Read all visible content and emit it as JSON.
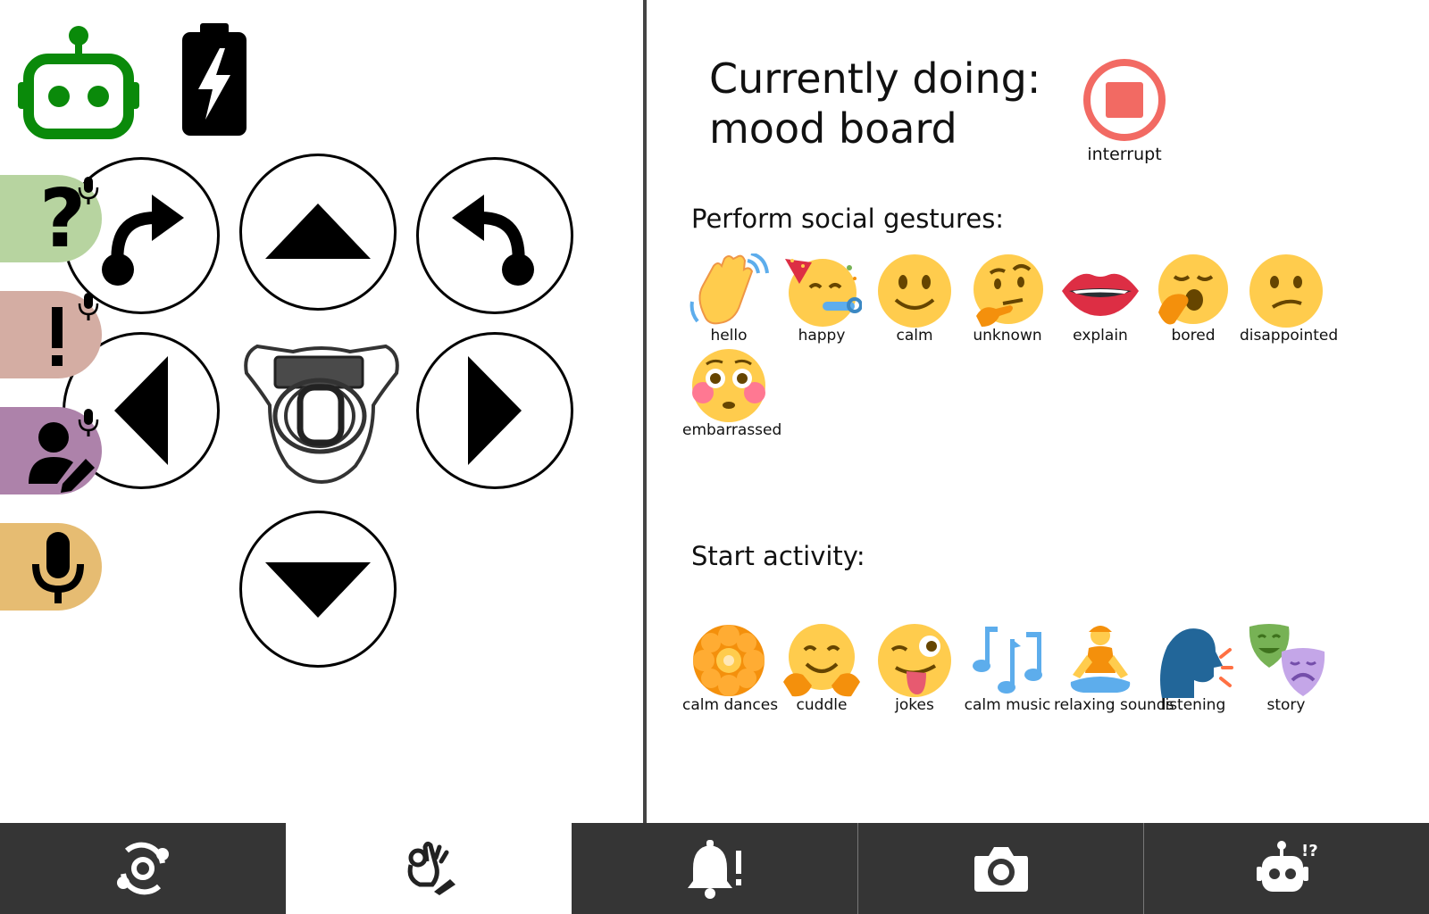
{
  "status": {
    "robot_icon": "robot-connected-icon",
    "robot_color": "#0a8a0a",
    "battery_icon": "battery-charging-icon"
  },
  "side_buttons": [
    {
      "name": "help-button",
      "icon": "question-mark-icon",
      "color": "#b7d4a0"
    },
    {
      "name": "alert-button",
      "icon": "exclamation-icon",
      "color": "#d4ada3"
    },
    {
      "name": "user-edit-button",
      "icon": "user-edit-icon",
      "color": "#ad82aa"
    },
    {
      "name": "microphone-button",
      "icon": "microphone-icon",
      "color": "#e6bc72"
    }
  ],
  "navigation": {
    "buttons": [
      "turn-right",
      "forward",
      "turn-left",
      "left",
      "right",
      "backward"
    ],
    "center_icon": "robot-head-icon"
  },
  "current": {
    "line1": "Currently doing:",
    "line2": "mood board"
  },
  "interrupt": {
    "label": "interrupt",
    "color": "#f26a63"
  },
  "gestures": {
    "title": "Perform social gestures:",
    "items": [
      {
        "label": "hello",
        "icon": "waving-hand-icon"
      },
      {
        "label": "happy",
        "icon": "partying-face-icon"
      },
      {
        "label": "calm",
        "icon": "slightly-smiling-face-icon"
      },
      {
        "label": "unknown",
        "icon": "thinking-face-icon"
      },
      {
        "label": "explain",
        "icon": "mouth-icon"
      },
      {
        "label": "bored",
        "icon": "yawning-face-icon"
      },
      {
        "label": "disappointed",
        "icon": "confused-face-icon"
      },
      {
        "label": "embarrassed",
        "icon": "flushed-face-icon"
      }
    ]
  },
  "activities": {
    "title": "Start activity:",
    "items": [
      {
        "label": "calm dances",
        "icon": "flower-icon"
      },
      {
        "label": "cuddle",
        "icon": "hugging-face-icon"
      },
      {
        "label": "jokes",
        "icon": "winking-tongue-face-icon"
      },
      {
        "label": "calm music",
        "icon": "music-notes-icon"
      },
      {
        "label": "relaxing sounds",
        "icon": "meditating-person-icon"
      },
      {
        "label": "listening",
        "icon": "speaking-head-icon"
      },
      {
        "label": "story",
        "icon": "theater-masks-icon"
      }
    ]
  },
  "tabs": [
    {
      "name": "tab-connection",
      "icon": "connection-icon",
      "active": false
    },
    {
      "name": "tab-gestures",
      "icon": "gesture-ok-hand-icon",
      "active": true
    },
    {
      "name": "tab-notifications",
      "icon": "bell-alert-icon",
      "active": false
    },
    {
      "name": "tab-camera",
      "icon": "camera-icon",
      "active": false
    },
    {
      "name": "tab-robot-help",
      "icon": "robot-question-icon",
      "active": false
    }
  ],
  "colors": {
    "tab_bar": "#353535",
    "divider": "#444444",
    "emoji_yellow": "#ffcc4d",
    "emoji_dark": "#664500"
  }
}
